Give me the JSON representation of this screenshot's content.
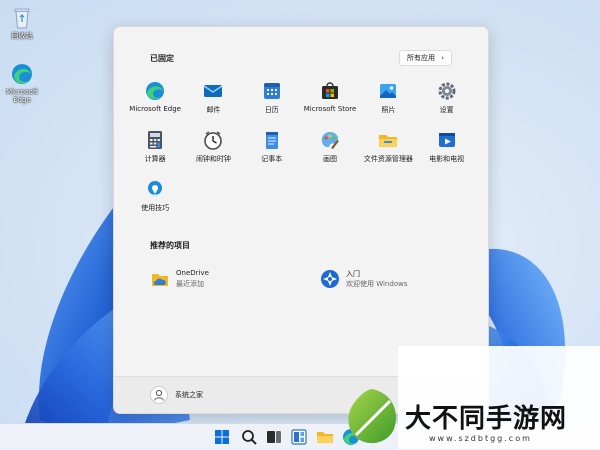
{
  "desktop": {
    "icons": [
      {
        "label": "回收站",
        "icon": "recycle-bin-icon"
      },
      {
        "label": "Microsoft Edge",
        "icon": "edge-icon"
      }
    ]
  },
  "start_menu": {
    "pinned_title": "已固定",
    "all_apps_label": "所有应用",
    "all_apps_chevron": "›",
    "pinned": [
      {
        "label": "Microsoft Edge",
        "icon": "edge-icon"
      },
      {
        "label": "邮件",
        "icon": "mail-icon"
      },
      {
        "label": "日历",
        "icon": "calendar-icon"
      },
      {
        "label": "Microsoft Store",
        "icon": "store-icon"
      },
      {
        "label": "照片",
        "icon": "photos-icon"
      },
      {
        "label": "设置",
        "icon": "settings-icon"
      },
      {
        "label": "计算器",
        "icon": "calculator-icon"
      },
      {
        "label": "闹钟和时钟",
        "icon": "clock-icon"
      },
      {
        "label": "记事本",
        "icon": "notepad-icon"
      },
      {
        "label": "画图",
        "icon": "paint-icon"
      },
      {
        "label": "文件资源管理器",
        "icon": "file-explorer-icon"
      },
      {
        "label": "电影和电视",
        "icon": "movies-tv-icon"
      },
      {
        "label": "使用技巧",
        "icon": "tips-icon"
      }
    ],
    "recommended_title": "推荐的项目",
    "recommended": [
      {
        "title": "OneDrive",
        "subtitle": "最近添加",
        "icon": "onedrive-icon"
      },
      {
        "title": "入门",
        "subtitle": "欢迎使用 Windows",
        "icon": "get-started-icon"
      }
    ],
    "user_name": "系统之家"
  },
  "taskbar": {
    "items": [
      "windows-start-icon",
      "search-icon",
      "task-view-icon",
      "widgets-icon",
      "file-explorer-icon",
      "edge-icon"
    ]
  },
  "watermark": {
    "name": "大不同手游网",
    "url": "www.szdbtgg.com"
  },
  "colors": {
    "accent": "#0067c0",
    "menu_bg": "#f3f3f3",
    "bloom": "#1e5fd6"
  }
}
